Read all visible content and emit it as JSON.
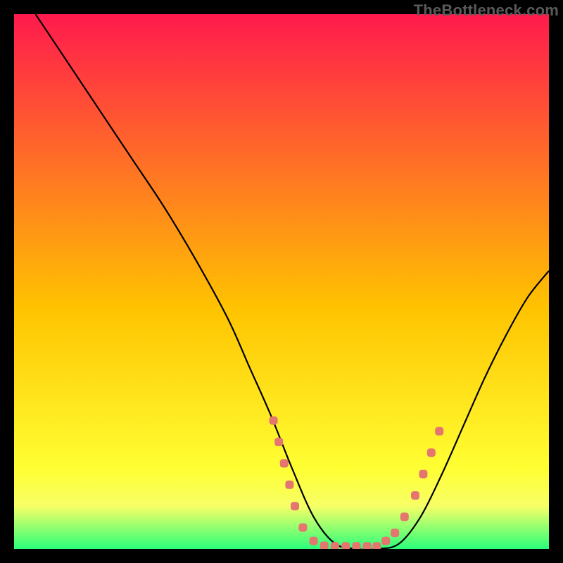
{
  "attribution": "TheBottleneck.com",
  "colors": {
    "bg": "#000000",
    "grad_top": "#ff1a4d",
    "grad_55": "#ffc300",
    "grad_85": "#ffff33",
    "grad_92": "#f7ff66",
    "grad_bottom": "#2bff7a",
    "curve": "#000000",
    "marker": "#e4766f"
  },
  "chart_data": {
    "type": "line",
    "title": "",
    "xlabel": "",
    "ylabel": "",
    "xlim": [
      0,
      100
    ],
    "ylim": [
      0,
      100
    ],
    "grid": false,
    "series": [
      {
        "name": "bottleneck-curve",
        "x": [
          4,
          10,
          16,
          22,
          28,
          34,
          40,
          44,
          48,
          52,
          56,
          60,
          64,
          68,
          72,
          76,
          80,
          84,
          88,
          92,
          96,
          100
        ],
        "values": [
          100,
          91,
          82,
          73,
          64,
          54,
          43,
          34,
          25,
          15,
          6,
          1,
          0,
          0,
          1,
          6,
          14,
          23,
          32,
          40,
          47,
          52
        ]
      }
    ],
    "markers": [
      {
        "x": 48.5,
        "y": 24
      },
      {
        "x": 49.5,
        "y": 20
      },
      {
        "x": 50.5,
        "y": 16
      },
      {
        "x": 51.5,
        "y": 12
      },
      {
        "x": 52.5,
        "y": 8
      },
      {
        "x": 54,
        "y": 4
      },
      {
        "x": 56,
        "y": 1.5
      },
      {
        "x": 58,
        "y": 0.6
      },
      {
        "x": 60,
        "y": 0.5
      },
      {
        "x": 62,
        "y": 0.5
      },
      {
        "x": 64,
        "y": 0.5
      },
      {
        "x": 66,
        "y": 0.5
      },
      {
        "x": 67.8,
        "y": 0.5
      },
      {
        "x": 69.5,
        "y": 1.5
      },
      {
        "x": 71.2,
        "y": 3
      },
      {
        "x": 73,
        "y": 6
      },
      {
        "x": 75,
        "y": 10
      },
      {
        "x": 76.5,
        "y": 14
      },
      {
        "x": 78,
        "y": 18
      },
      {
        "x": 79.5,
        "y": 22
      }
    ]
  }
}
